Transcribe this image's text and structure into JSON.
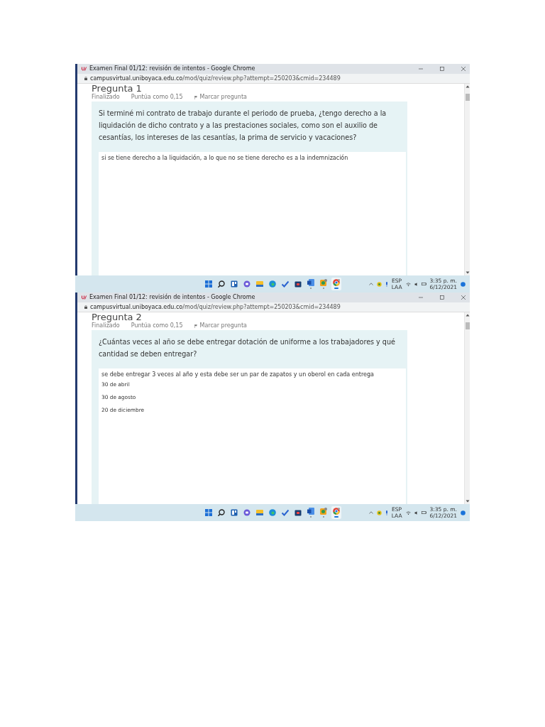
{
  "screenshots": [
    {
      "window": {
        "title": "Examen Final 01/12: revisión de intentos - Google Chrome",
        "url_host": "campusvirtual.uniboyaca.edu.co",
        "url_path": "/mod/quiz/review.php?attempt=250203&cmid=234489"
      },
      "question": {
        "heading": "Pregunta 1",
        "state": "Finalizado",
        "score": "Puntúa como 0,15",
        "flag": "Marcar pregunta",
        "text": "Si terminé mi contrato de trabajo durante el periodo de prueba, ¿tengo derecho a la liquidación de dicho contrato y a las prestaciones sociales, como son el auxilio de cesantías, los intereses de las cesantías, la prima de servicio y vacaciones?",
        "answer": "si se tiene derecho a la liquidación, a lo que no se tiene derecho es a la indemnización"
      },
      "taskbar": {
        "apps": [
          {
            "kind": "start",
            "running": false,
            "active": false
          },
          {
            "kind": "search",
            "running": false,
            "active": false
          },
          {
            "kind": "widgets",
            "running": false,
            "active": false
          },
          {
            "kind": "chat",
            "running": false,
            "active": false
          },
          {
            "kind": "folder",
            "running": false,
            "active": false
          },
          {
            "kind": "edge",
            "running": false,
            "active": false
          },
          {
            "kind": "todo",
            "running": false,
            "active": false
          },
          {
            "kind": "store",
            "running": false,
            "active": false
          },
          {
            "kind": "word",
            "running": true,
            "active": false
          },
          {
            "kind": "photos",
            "running": true,
            "active": false
          },
          {
            "kind": "chrome",
            "running": true,
            "active": true
          }
        ],
        "language": "ESP",
        "layout": "LAA",
        "time": "3:35 p. m.",
        "date": "6/12/2021"
      }
    },
    {
      "window": {
        "title": "Examen Final 01/12: revisión de intentos - Google Chrome",
        "url_host": "campusvirtual.uniboyaca.edu.co",
        "url_path": "/mod/quiz/review.php?attempt=250203&cmid=234489"
      },
      "question": {
        "heading": "Pregunta 2",
        "state": "Finalizado",
        "score": "Puntúa como 0,15",
        "flag": "Marcar pregunta",
        "text": "¿Cuántas veces al año se debe entregar dotación de uniforme a los trabajadores y qué cantidad se deben entregar?",
        "answer": "se debe entregar 3 veces al año y esta debe ser un par de zapatos y un oberol en cada entrega",
        "answer_lines": [
          "30 de abril",
          "30 de agosto",
          "20 de diciembre"
        ]
      },
      "taskbar": {
        "apps": [
          {
            "kind": "start",
            "running": false,
            "active": false
          },
          {
            "kind": "search",
            "running": false,
            "active": false
          },
          {
            "kind": "widgets",
            "running": false,
            "active": false
          },
          {
            "kind": "chat",
            "running": false,
            "active": false
          },
          {
            "kind": "folder",
            "running": false,
            "active": false
          },
          {
            "kind": "edge",
            "running": false,
            "active": false
          },
          {
            "kind": "todo",
            "running": false,
            "active": false
          },
          {
            "kind": "store",
            "running": false,
            "active": false
          },
          {
            "kind": "word",
            "running": true,
            "active": false
          },
          {
            "kind": "photos",
            "running": true,
            "active": false
          },
          {
            "kind": "chrome",
            "running": true,
            "active": true
          }
        ],
        "language": "ESP",
        "layout": "LAA",
        "time": "3:35 p. m.",
        "date": "6/12/2021"
      }
    }
  ]
}
